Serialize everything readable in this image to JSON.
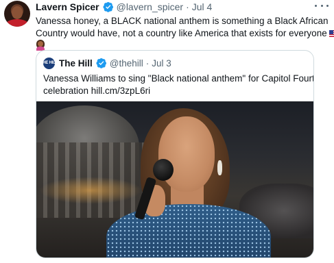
{
  "tweet": {
    "author_name": "Lavern Spicer",
    "author_handle": "@lavern_spicer",
    "separator": "·",
    "date": "Jul 4",
    "text_line1": "Vanessa honey, a BLACK national anthem is something a Black African",
    "text_line2": "Country would have, not a country like America that exists for everyone",
    "icons": {
      "verified": "verified-badge-icon",
      "more": "more-options-icon",
      "flag": "us-flag-emoji",
      "emoji": "woman-shrugging-emoji"
    }
  },
  "quoted": {
    "author_name": "The Hill",
    "avatar_text": "THE HILL",
    "author_handle": "@thehill",
    "separator": "·",
    "date": "Jul 3",
    "text_line1": "Vanessa Williams to sing \"Black national anthem\" for Capitol Fourth",
    "text_line2": "celebration hill.cm/3zpL6ri"
  },
  "colors": {
    "text_primary": "#0f1419",
    "text_secondary": "#536471",
    "verified_blue": "#1d9bf0",
    "border": "#cfd9de"
  }
}
